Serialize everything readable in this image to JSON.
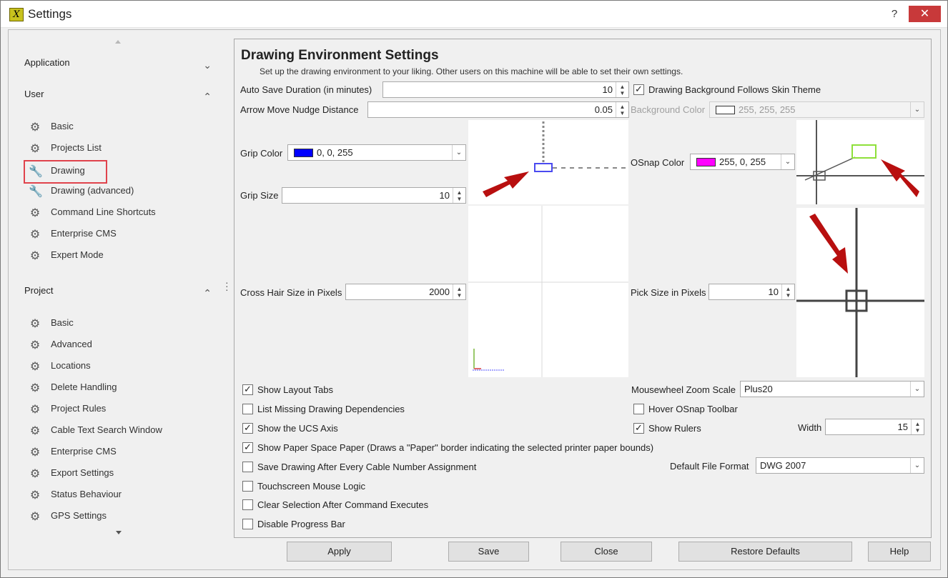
{
  "window": {
    "title": "Settings",
    "help_label": "?",
    "close_label": "✕",
    "app_icon_label": "X"
  },
  "sidebar": {
    "sections": {
      "application": {
        "label": "Application",
        "chevron": "⌄"
      },
      "user": {
        "label": "User",
        "chevron": "⌃"
      },
      "project": {
        "label": "Project",
        "chevron": "⌃"
      }
    },
    "user_items": [
      {
        "label": "Basic",
        "icon": "gear-icon"
      },
      {
        "label": "Projects List",
        "icon": "gear-icon"
      },
      {
        "label": "Drawing",
        "icon": "wrench-icon"
      },
      {
        "label": "Drawing (advanced)",
        "icon": "wrench-icon"
      },
      {
        "label": "Command Line Shortcuts",
        "icon": "gear-icon"
      },
      {
        "label": "Enterprise CMS",
        "icon": "gear-icon"
      },
      {
        "label": "Expert Mode",
        "icon": "gear-icon"
      }
    ],
    "project_items": [
      {
        "label": "Basic",
        "icon": "gear-icon"
      },
      {
        "label": "Advanced",
        "icon": "gear-icon"
      },
      {
        "label": "Locations",
        "icon": "gear-icon"
      },
      {
        "label": "Delete Handling",
        "icon": "gear-icon"
      },
      {
        "label": "Project Rules",
        "icon": "gear-icon"
      },
      {
        "label": "Cable Text Search Window",
        "icon": "gear-icon"
      },
      {
        "label": "Enterprise CMS",
        "icon": "gear-icon"
      },
      {
        "label": "Export Settings",
        "icon": "gear-icon"
      },
      {
        "label": "Status Behaviour",
        "icon": "gear-icon"
      },
      {
        "label": "GPS Settings",
        "icon": "gear-icon"
      }
    ],
    "selected_item": "Drawing"
  },
  "panel": {
    "title": "Drawing Environment Settings",
    "subtitle": "Set up the drawing environment to your liking. Other users on this machine will be able to set their own settings.",
    "auto_save": {
      "label": "Auto Save Duration (in minutes)",
      "value": "10"
    },
    "nudge": {
      "label": "Arrow Move Nudge Distance",
      "value": "0.05"
    },
    "bg_follows_theme": {
      "label": "Drawing Background Follows Skin Theme",
      "checked": true
    },
    "background_color": {
      "label": "Background Color",
      "value": "255, 255, 255",
      "swatch": "#ffffff",
      "disabled": true
    },
    "grip_color": {
      "label": "Grip Color",
      "value": "0, 0, 255",
      "swatch": "#0000ff"
    },
    "grip_size": {
      "label": "Grip Size",
      "value": "10"
    },
    "osnap_color": {
      "label": "OSnap Color",
      "value": "255, 0, 255",
      "swatch": "#ff00ff"
    },
    "crosshair": {
      "label": "Cross Hair Size in Pixels",
      "value": "2000"
    },
    "pick_size": {
      "label": "Pick Size in Pixels",
      "value": "10"
    },
    "checkboxes": [
      {
        "label": "Show Layout Tabs",
        "checked": true
      },
      {
        "label": "List Missing Drawing Dependencies",
        "checked": false
      },
      {
        "label": "Show the UCS Axis",
        "checked": true
      },
      {
        "label": "Show Paper Space Paper (Draws a \"Paper\" border indicating the selected printer paper bounds)",
        "checked": true
      },
      {
        "label": "Save Drawing After Every Cable Number Assignment",
        "checked": false
      },
      {
        "label": "Touchscreen Mouse Logic",
        "checked": false
      },
      {
        "label": "Clear Selection After Command Executes",
        "checked": false
      },
      {
        "label": "Disable Progress Bar",
        "checked": false
      }
    ],
    "zoom_scale": {
      "label": "Mousewheel Zoom Scale",
      "value": "Plus20"
    },
    "hover_osnap": {
      "label": "Hover OSnap Toolbar",
      "checked": false
    },
    "show_rulers": {
      "label": "Show Rulers",
      "checked": true
    },
    "ruler_width": {
      "label": "Width",
      "value": "15"
    },
    "file_format": {
      "label": "Default File Format",
      "value": "DWG 2007"
    }
  },
  "buttons": {
    "apply": "Apply",
    "save": "Save",
    "close": "Close",
    "restore": "Restore Defaults",
    "help": "Help"
  },
  "colors": {
    "accent_red": "#e0434c",
    "close_red": "#c8393a",
    "arrow_red": "#b80f0f"
  }
}
